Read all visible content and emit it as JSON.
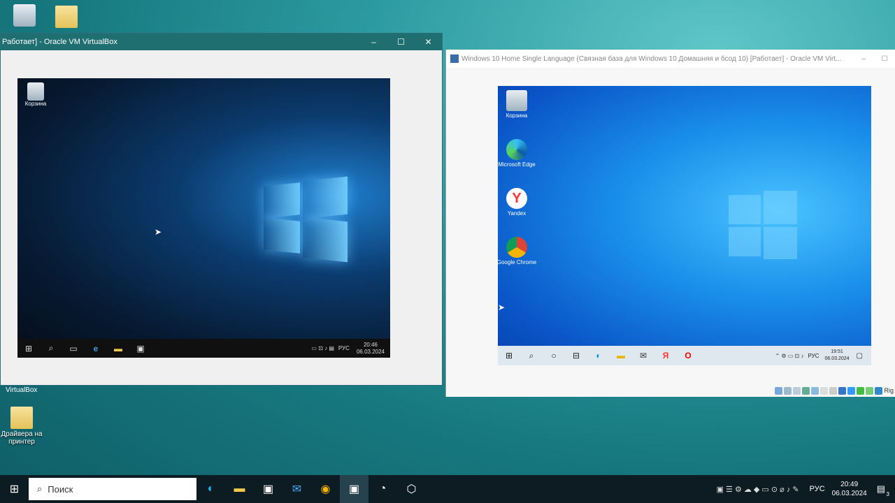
{
  "desktop": {
    "icons": [
      {
        "label": ""
      },
      {
        "label": ""
      },
      {
        "label": "Драйвера на принтер"
      }
    ],
    "partial_label": "VirtualBox"
  },
  "window1": {
    "title": "Работает] - Oracle VM VirtualBox",
    "guest": {
      "recycle_label": "Корзина",
      "lang": "РУС",
      "time": "20:46",
      "date": "06.03.2024"
    }
  },
  "window2": {
    "title": "Windows 10 Home Single Language (Связная база для Windows 10 Домашняя и бсод 10) [Работает] - Oracle VM Virt...",
    "guest": {
      "icons": [
        {
          "label": "Корзина"
        },
        {
          "label": "Microsoft Edge"
        },
        {
          "label": "Yandex"
        },
        {
          "label": "Google Chrome"
        }
      ],
      "lang": "РУС",
      "time": "19:51",
      "date": "06.03.2024"
    },
    "statusbar_hint": "Rig"
  },
  "host_taskbar": {
    "search_placeholder": "Поиск",
    "lang": "РУС",
    "time": "20:49",
    "date": "06.03.2024",
    "notifications": "3"
  },
  "colors": {
    "win1_title": "#1f6f70",
    "host_taskbar": "#0d1b22",
    "accent": "#0078d7"
  }
}
